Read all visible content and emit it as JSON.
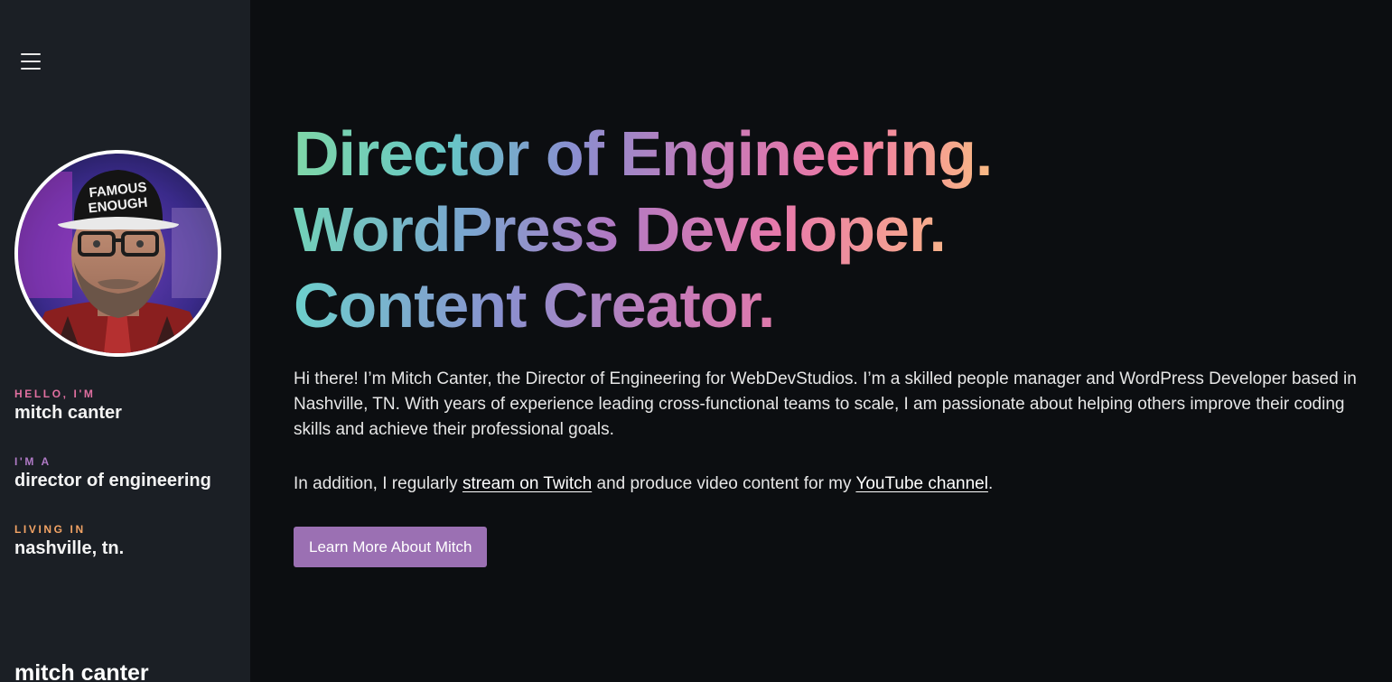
{
  "sidebar": {
    "menu_icon": "hamburger-menu-icon",
    "avatar_caption": "FAMOUS ENOUGH",
    "hello_kicker": "HELLO, I'M",
    "hello_value": "mitch canter",
    "role_kicker": "I'M A",
    "role_value": "director of engineering",
    "living_kicker": "LIVING IN",
    "living_value": "nashville, tn.",
    "footer_name": "mitch canter",
    "colors": {
      "hello_kicker": "#e06fa0",
      "role_kicker": "#b07ac6",
      "living_kicker": "#f2a365",
      "background": "#1b1f25"
    }
  },
  "main": {
    "headline": [
      "Director of Engineering.",
      "WordPress Developer.",
      "Content Creator."
    ],
    "bio_paragraph": "Hi there! I’m Mitch Canter, the Director of Engineering for WebDevStudios. I’m a skilled people manager and WordPress Developer based in Nashville, TN. With years of experience leading cross-functional teams to scale, I am passionate about helping others improve their coding skills and achieve their professional goals.",
    "bio2_prefix": "In addition, I regularly ",
    "twitch_link": "stream on Twitch",
    "bio2_middle": " and produce video content for my ",
    "youtube_link": "YouTube channel",
    "bio2_suffix": ".",
    "cta_label": "Learn More About Mitch",
    "colors": {
      "background": "#0c0e11",
      "cta_background": "#9b70b3"
    }
  }
}
